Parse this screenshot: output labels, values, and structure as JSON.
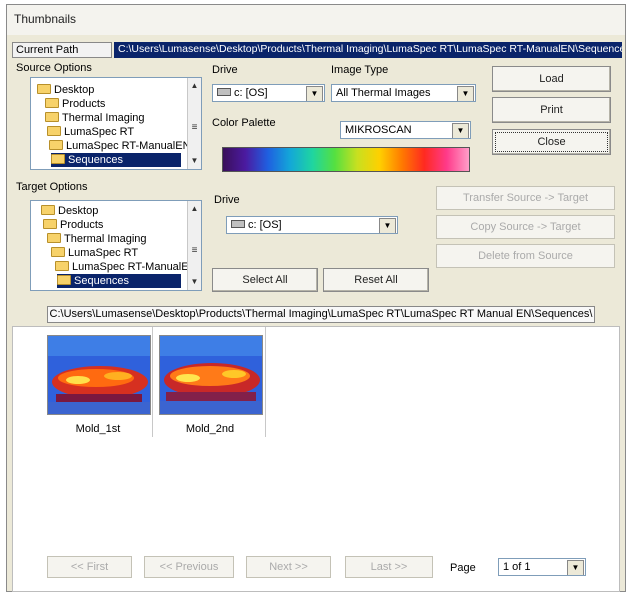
{
  "window": {
    "title": "Thumbnails"
  },
  "current_path": {
    "label": "Current Path",
    "value": "C:\\Users\\Lumasense\\Desktop\\Products\\Thermal Imaging\\LumaSpec RT\\LumaSpec RT-ManualEN\\Sequences"
  },
  "source": {
    "group_label": "Source Options",
    "tree": [
      "Desktop",
      "Products",
      "Thermal Imaging",
      "LumaSpec RT",
      "LumaSpec RT-ManualEN",
      "Sequences"
    ],
    "drive_label": "Drive",
    "drive_value": "c: [OS]",
    "image_type_label": "Image Type",
    "image_type_value": "All Thermal Images",
    "palette_label": "Color Palette",
    "palette_value": "MIKROSCAN"
  },
  "buttons": {
    "load": "Load",
    "print": "Print",
    "close": "Close"
  },
  "target": {
    "group_label": "Target Options",
    "tree": [
      "Desktop",
      "Products",
      "Thermal Imaging",
      "LumaSpec RT",
      "LumaSpec RT-ManualEN",
      "Sequences"
    ],
    "drive_label": "Drive",
    "drive_value": "c: [OS]",
    "select_all": "Select All",
    "reset_all": "Reset All",
    "transfer": "Transfer Source -> Target",
    "copy": "Copy Source -> Target",
    "delete": "Delete from Source"
  },
  "gallery": {
    "path": "C:\\Users\\Lumasense\\Desktop\\Products\\Thermal Imaging\\LumaSpec RT\\LumaSpec RT Manual EN\\Sequences\\",
    "items": [
      {
        "name": "Mold_1st"
      },
      {
        "name": "Mold_2nd"
      }
    ]
  },
  "pager": {
    "first": "<< First",
    "previous": "<< Previous",
    "next": "Next >>",
    "last": "Last >>",
    "page_label": "Page",
    "page_value": "1 of 1"
  }
}
